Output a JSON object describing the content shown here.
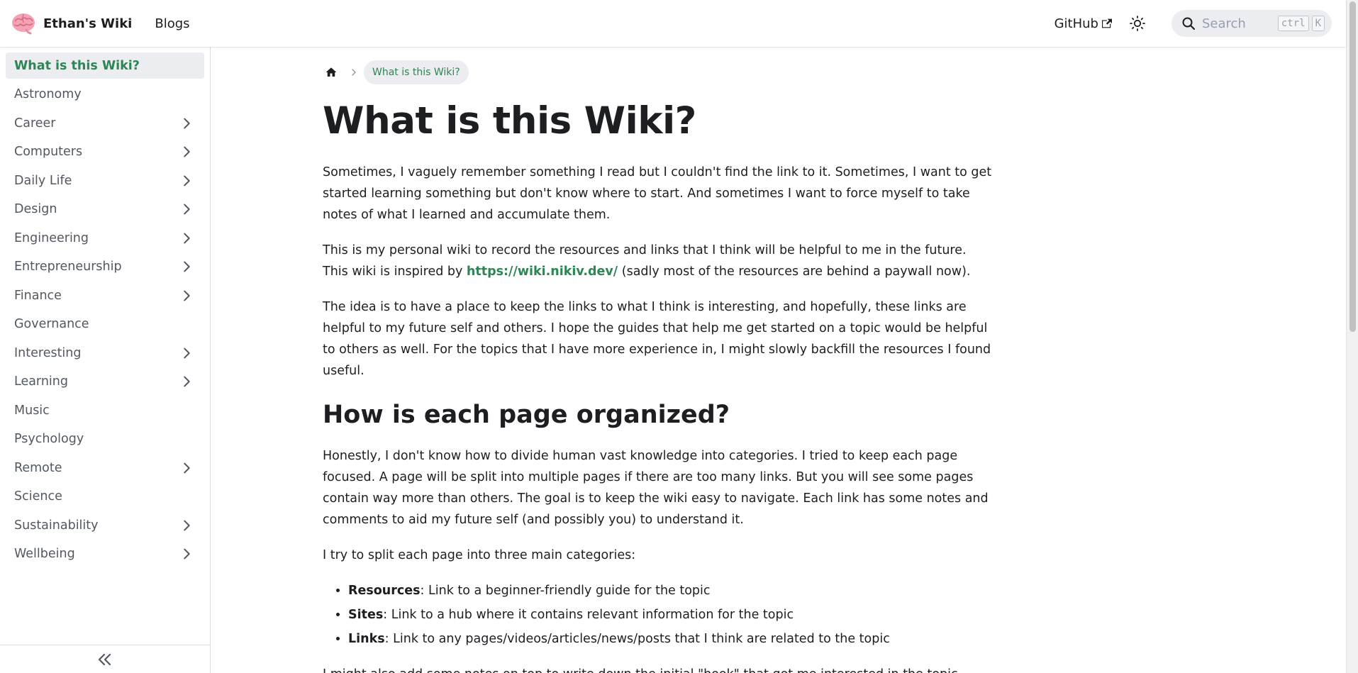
{
  "navbar": {
    "brand_title": "Ethan's Wiki",
    "blogs_label": "Blogs",
    "github_label": "GitHub",
    "search": {
      "placeholder": "Search",
      "key_ctrl": "ctrl",
      "key_k": "K"
    }
  },
  "sidebar": {
    "items": [
      {
        "label": "What is this Wiki?",
        "active": true,
        "expandable": false
      },
      {
        "label": "Astronomy",
        "expandable": false
      },
      {
        "label": "Career",
        "expandable": true
      },
      {
        "label": "Computers",
        "expandable": true
      },
      {
        "label": "Daily Life",
        "expandable": true
      },
      {
        "label": "Design",
        "expandable": true
      },
      {
        "label": "Engineering",
        "expandable": true
      },
      {
        "label": "Entrepreneurship",
        "expandable": true
      },
      {
        "label": "Finance",
        "expandable": true
      },
      {
        "label": "Governance",
        "expandable": false
      },
      {
        "label": "Interesting",
        "expandable": true
      },
      {
        "label": "Learning",
        "expandable": true
      },
      {
        "label": "Music",
        "expandable": false
      },
      {
        "label": "Psychology",
        "expandable": false
      },
      {
        "label": "Remote",
        "expandable": true
      },
      {
        "label": "Science",
        "expandable": false
      },
      {
        "label": "Sustainability",
        "expandable": true
      },
      {
        "label": "Wellbeing",
        "expandable": true
      }
    ]
  },
  "breadcrumb": {
    "current": "What is this Wiki?"
  },
  "doc": {
    "title": "What is this Wiki?",
    "p1": "Sometimes, I vaguely remember something I read but I couldn't find the link to it. Sometimes, I want to get started learning something but don't know where to start. And sometimes I want to force myself to take notes of what I learned and accumulate them.",
    "p2_before": "This is my personal wiki to record the resources and links that I think will be helpful to me in the future. This wiki is inspired by ",
    "p2_link": "https://wiki.nikiv.dev/",
    "p2_after": " (sadly most of the resources are behind a paywall now).",
    "p3": "The idea is to have a place to keep the links to what I think is interesting, and hopefully, these links are helpful to my future self and others. I hope the guides that help me get started on a topic would be helpful to others as well. For the topics that I have more experience in, I might slowly backfill the resources I found useful.",
    "h2": "How is each page organized?",
    "p4": "Honestly, I don't know how to divide human vast knowledge into categories. I tried to keep each page focused. A page will be split into multiple pages if there are too many links. But you will see some pages contain way more than others. The goal is to keep the wiki easy to navigate. Each link has some notes and comments to aid my future self (and possibly you) to understand it.",
    "p5": "I try to split each page into three main categories:",
    "list": [
      {
        "term": "Resources",
        "desc": ": Link to a beginner-friendly guide for the topic"
      },
      {
        "term": "Sites",
        "desc": ": Link to a hub where it contains relevant information for the topic"
      },
      {
        "term": "Links",
        "desc": ": Link to any pages/videos/articles/news/posts that I think are related to the topic"
      }
    ],
    "p6": "I might also add some notes on top to write down the initial \"hook\" that got me interested in the topic. Often times"
  },
  "colors": {
    "accent": "#2e8555",
    "text": "#1c1e21",
    "muted": "#525860",
    "surface": "#ebedf0"
  }
}
